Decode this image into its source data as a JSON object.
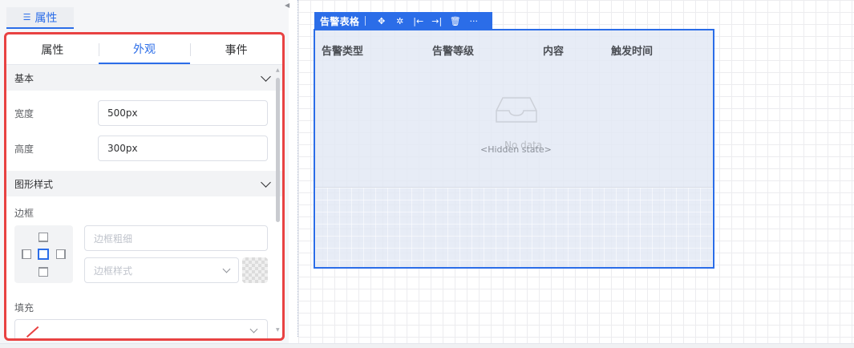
{
  "left_panel": {
    "top_tab": {
      "icon": "settings-sliders-icon",
      "label": "属性"
    },
    "subtabs": [
      {
        "label": "属性",
        "active": false
      },
      {
        "label": "外观",
        "active": true
      },
      {
        "label": "事件",
        "active": false
      }
    ],
    "sections": {
      "basic": {
        "title": "基本",
        "width_label": "宽度",
        "width_value": "500px",
        "height_label": "高度",
        "height_value": "300px"
      },
      "shape_style": {
        "title": "图形样式",
        "border_label": "边框",
        "border_width_placeholder": "边框粗细",
        "border_style_placeholder": "边框样式",
        "fill_label": "填充"
      }
    }
  },
  "canvas": {
    "toolbar": {
      "title": "告警表格",
      "icons": [
        "move-icon",
        "bug-icon",
        "align-left-icon",
        "align-right-icon",
        "delete-icon",
        "more-icon"
      ],
      "glyphs": [
        "✥",
        "✲",
        "|←",
        "→|",
        "🗑",
        "···"
      ]
    },
    "table": {
      "columns": [
        "告警类型",
        "告警等级",
        "内容",
        "触发时间"
      ],
      "empty_text": "No data",
      "hidden_state": "<Hidden state>"
    }
  },
  "colors": {
    "accent": "#2b6de8",
    "highlight_border": "#e84242"
  }
}
